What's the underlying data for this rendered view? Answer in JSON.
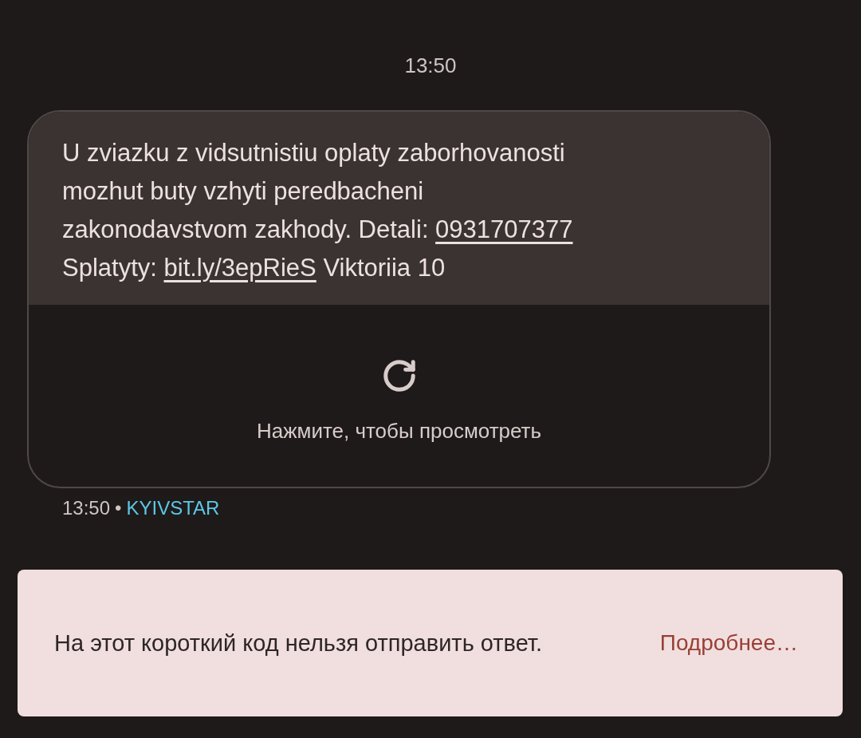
{
  "timestamp": "13:50",
  "message": {
    "lines": [
      [
        {
          "kind": "text",
          "text": "U zviazku z vidsutnistiu oplaty zaborhovanosti"
        }
      ],
      [
        {
          "kind": "text",
          "text": "mozhut buty vzhyti peredbacheni"
        }
      ],
      [
        {
          "kind": "text",
          "text": "zakonodavstvom zakhody. Detali: "
        },
        {
          "kind": "link",
          "text": "0931707377"
        }
      ],
      [
        {
          "kind": "text",
          "text": "Splatyty: "
        },
        {
          "kind": "link",
          "text": "bit.ly/3epRieS"
        },
        {
          "kind": "text",
          "text": " Viktoriia 10"
        }
      ]
    ],
    "preview_label": "Нажмите, чтобы просмотреть",
    "time": "13:50",
    "separator": "•",
    "sender": "KYIVSTAR"
  },
  "notice": {
    "text": "На этот короткий код нельзя отправить ответ.",
    "action": "Подробнее…"
  }
}
